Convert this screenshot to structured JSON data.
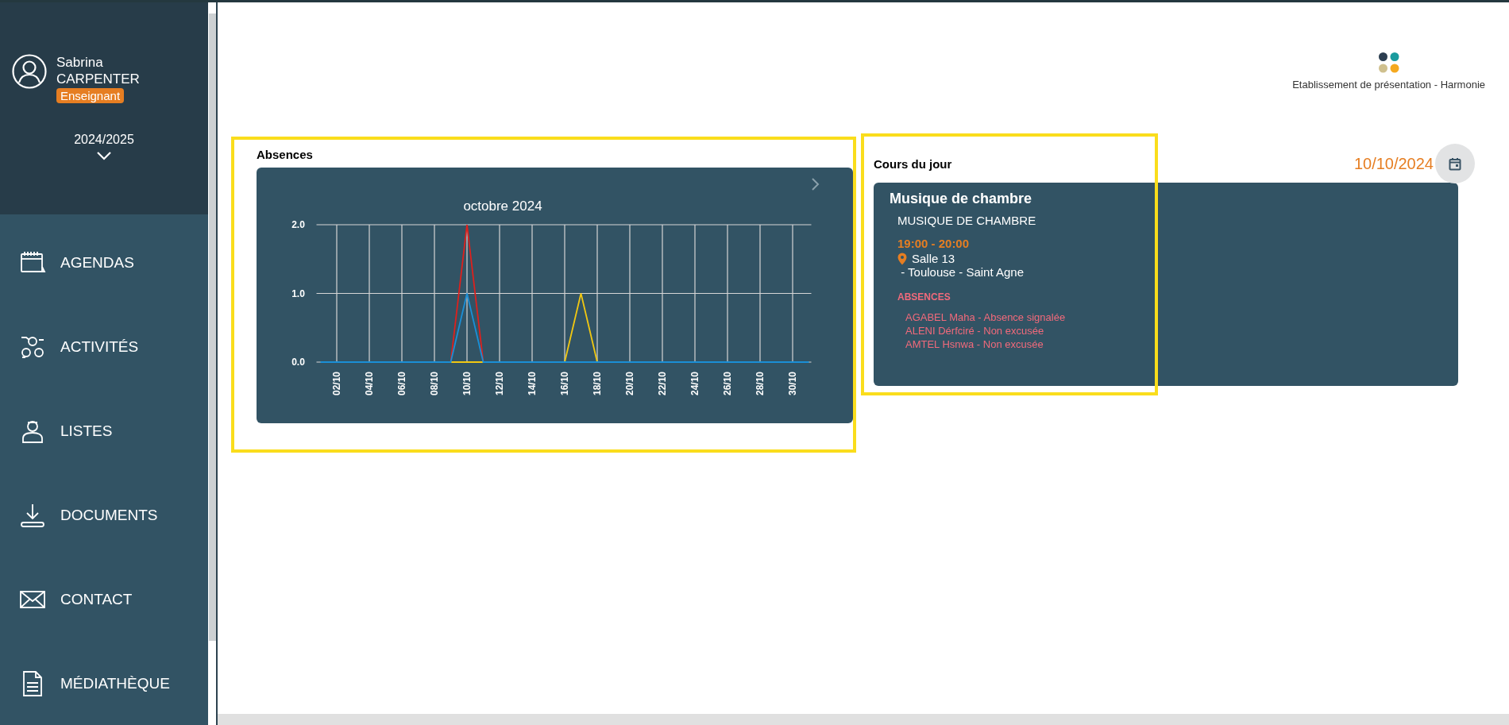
{
  "user": {
    "first_name": "Sabrina",
    "last_name": "CARPENTER",
    "role": "Enseignant",
    "year": "2024/2025"
  },
  "menu": [
    {
      "label": "AGENDAS"
    },
    {
      "label": "ACTIVITÉS"
    },
    {
      "label": "LISTES"
    },
    {
      "label": "DOCUMENTS"
    },
    {
      "label": "CONTACT"
    },
    {
      "label": "MÉDIATHÈQUE"
    }
  ],
  "header": {
    "establishment": "Etablissement de présentation - Harmonie"
  },
  "absences": {
    "title": "Absences",
    "chart_data": {
      "type": "line",
      "title": "octobre 2024",
      "categories": [
        null,
        "02/10",
        null,
        "04/10",
        null,
        "06/10",
        null,
        "08/10",
        null,
        "10/10",
        null,
        "12/10",
        null,
        "14/10",
        null,
        "16/10",
        null,
        "18/10",
        null,
        "20/10",
        null,
        "22/10",
        null,
        "24/10",
        null,
        "26/10",
        null,
        "28/10",
        null,
        "30/10",
        null
      ],
      "series": [
        {
          "color": "#e0201c",
          "values": [
            null,
            null,
            null,
            null,
            null,
            null,
            null,
            null,
            0,
            2,
            0,
            null,
            null,
            null,
            null,
            null,
            null,
            null,
            null,
            null,
            null,
            null,
            null,
            null,
            null,
            null,
            null,
            null,
            null,
            null,
            null
          ]
        },
        {
          "color": "#f2c811",
          "values": [
            null,
            null,
            null,
            null,
            null,
            null,
            null,
            null,
            0,
            0,
            0,
            null,
            null,
            null,
            null,
            0,
            1,
            0,
            null,
            null,
            null,
            null,
            null,
            null,
            null,
            null,
            null,
            null,
            null,
            null,
            null
          ]
        },
        {
          "color": "#1b8fd6",
          "values": [
            0,
            0,
            0,
            0,
            0,
            0,
            0,
            0,
            0,
            1,
            0,
            0,
            0,
            0,
            0,
            0,
            0,
            0,
            0,
            0,
            0,
            0,
            0,
            0,
            0,
            0,
            0,
            0,
            0,
            0,
            0
          ]
        }
      ],
      "ylim": [
        0,
        2
      ],
      "grid": true,
      "yticks": [
        {
          "value": 0,
          "label": "0.0"
        },
        {
          "value": 1,
          "label": "1.0"
        },
        {
          "value": 2,
          "label": "2.0"
        }
      ]
    }
  },
  "courses": {
    "title": "Cours du jour",
    "date": "10/10/2024",
    "items": [
      {
        "name": "Musique de chambre",
        "subject": "MUSIQUE DE CHAMBRE",
        "time": "19:00 - 20:00",
        "room": "Salle 13",
        "place": " - Toulouse - Saint Agne",
        "absences_title": "ABSENCES",
        "absences": [
          "AGABEL Maha - Absence signalée",
          "ALENI Dérfciré - Non excusée",
          "AMTEL Hsnwa - Non excusée"
        ]
      }
    ]
  }
}
